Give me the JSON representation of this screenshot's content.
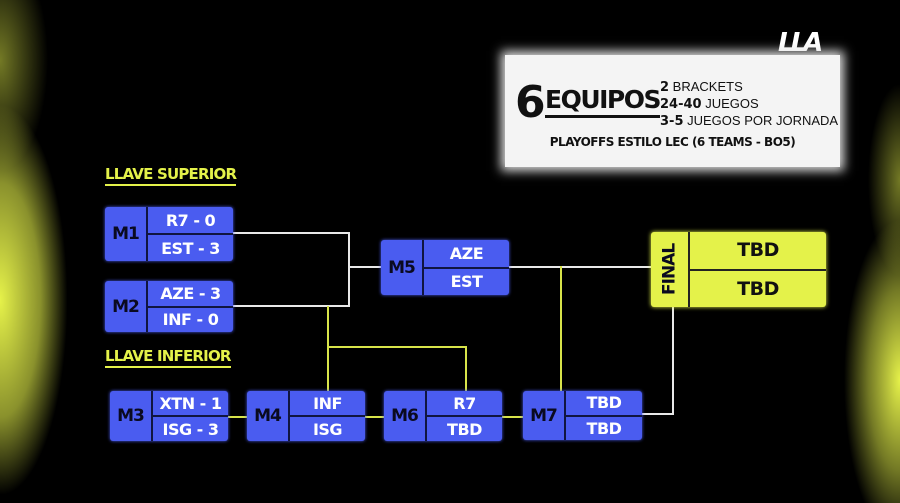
{
  "logo": "LLA",
  "info": {
    "count": "6",
    "title": "EQUIPOS",
    "stats": [
      {
        "num": "2",
        "text": "BRACKETS"
      },
      {
        "num": "24-40",
        "text": "JUEGOS"
      },
      {
        "num": "3-5",
        "text": "JUEGOS POR JORNADA"
      }
    ],
    "subtitle": "PLAYOFFS ESTILO LEC (6 TEAMS - BO5)"
  },
  "sections": {
    "upper": "LLAVE SUPERIOR",
    "lower": "LLAVE INFERIOR"
  },
  "matches": {
    "m1": {
      "id": "M1",
      "team1": "R7 - 0",
      "team2": "EST - 3"
    },
    "m2": {
      "id": "M2",
      "team1": "AZE - 3",
      "team2": "INF - 0"
    },
    "m3": {
      "id": "M3",
      "team1": "XTN - 1",
      "team2": "ISG - 3"
    },
    "m4": {
      "id": "M4",
      "team1": "INF",
      "team2": "ISG"
    },
    "m5": {
      "id": "M5",
      "team1": "AZE",
      "team2": "EST"
    },
    "m6": {
      "id": "M6",
      "team1": "R7",
      "team2": "TBD"
    },
    "m7": {
      "id": "M7",
      "team1": "TBD",
      "team2": "TBD"
    },
    "final": {
      "id": "FINAL",
      "team1": "TBD",
      "team2": "TBD"
    }
  },
  "colors": {
    "match": "#4a5cf0",
    "accent": "#e4f24a",
    "background": "#000000"
  }
}
